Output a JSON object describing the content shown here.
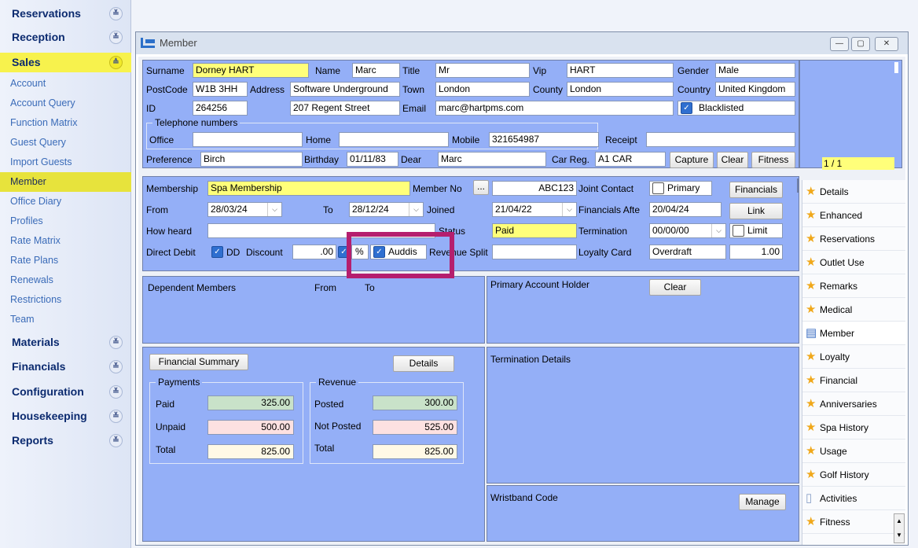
{
  "sidebar": {
    "sections": [
      {
        "label": "Reservations"
      },
      {
        "label": "Reception"
      },
      {
        "label": "Sales"
      }
    ],
    "sub_items": [
      "Account",
      "Account Query",
      "Function Matrix",
      "Guest Query",
      "Import Guests",
      "Member",
      "Office Diary",
      "Profiles",
      "Rate Matrix",
      "Rate Plans",
      "Renewals",
      "Restrictions",
      "Team"
    ],
    "bottom_sections": [
      "Materials",
      "Financials",
      "Configuration",
      "Housekeeping",
      "Reports"
    ],
    "active_section": "Sales",
    "active_item": "Member",
    "chevron_down": "≚",
    "chevron_up": "≙"
  },
  "window": {
    "title": "Member",
    "icon": "bed-icon"
  },
  "person": {
    "surname_label": "Surname",
    "surname": "Dorney HART",
    "name_label": "Name",
    "name": "Marc",
    "title_label": "Title",
    "title": "Mr",
    "vip_label": "Vip",
    "vip": "HART",
    "gender_label": "Gender",
    "gender": "Male",
    "postcode_label": "PostCode",
    "postcode": "W1B 3HH",
    "address_label": "Address",
    "address1": "Software Underground",
    "address2": "207 Regent Street",
    "town_label": "Town",
    "town": "London",
    "county_label": "County",
    "county": "London",
    "country_label": "Country",
    "country": "United Kingdom",
    "id_label": "ID",
    "id": "264256",
    "email_label": "Email",
    "email": "marc@hartpms.com",
    "blacklisted_label": "Blacklisted",
    "telephone_group": "Telephone numbers",
    "office_label": "Office",
    "office": "",
    "home_label": "Home",
    "home": "",
    "mobile_label": "Mobile",
    "mobile": "321654987",
    "receipt_label": "Receipt",
    "receipt": "",
    "preference_label": "Preference",
    "preference": "Birch",
    "birthday_label": "Birthday",
    "birthday": "01/11/83",
    "dear_label": "Dear",
    "dear": "Marc",
    "carreg_label": "Car Reg.",
    "carreg": "A1 CAR",
    "capture_btn": "Capture",
    "clear_btn": "Clear",
    "fitness_btn": "Fitness",
    "photo_counter": "1 / 1"
  },
  "membership": {
    "membership_label": "Membership",
    "membership": "Spa Membership",
    "member_no_label": "Member No",
    "member_no_btn": "...",
    "member_no": "ABC123",
    "joint_contact_label": "Joint Contact",
    "primary_label": "Primary",
    "financials_btn": "Financials",
    "from_label": "From",
    "from": "28/03/24",
    "to_label": "To",
    "to": "28/12/24",
    "joined_label": "Joined",
    "joined": "21/04/22",
    "financials_after_label": "Financials Afte",
    "financials_after": "20/04/24",
    "link_btn": "Link",
    "how_heard_label": "How heard",
    "how_heard": "",
    "status_label": "Status",
    "status": "Paid",
    "termination_label": "Termination",
    "termination": "00/00/00",
    "limit_label": "Limit",
    "direct_debit_label": "Direct Debit",
    "dd_label": "DD",
    "discount_label": "Discount",
    "discount": ".00",
    "percent_label": "%",
    "auddis_label": "Auddis",
    "revenue_split_label": "Revenue Split",
    "revenue_split": "",
    "loyalty_card_label": "Loyalty Card",
    "loyalty_card": "Overdraft",
    "loyalty_value": "1.00"
  },
  "dependents": {
    "title": "Dependent Members",
    "from": "From",
    "to": "To"
  },
  "primary_account": {
    "title": "Primary Account Holder",
    "clear_btn": "Clear"
  },
  "financial": {
    "summary_btn": "Financial Summary",
    "details_btn": "Details",
    "payments_group": "Payments",
    "revenue_group": "Revenue",
    "paid_label": "Paid",
    "paid": "325.00",
    "unpaid_label": "Unpaid",
    "unpaid": "500.00",
    "total_label": "Total",
    "total": "825.00",
    "posted_label": "Posted",
    "posted": "300.00",
    "not_posted_label": "Not Posted",
    "not_posted": "525.00",
    "rev_total_label": "Total",
    "rev_total": "825.00"
  },
  "termination_details": {
    "title": "Termination Details"
  },
  "wristband": {
    "title": "Wristband Code",
    "manage_btn": "Manage"
  },
  "tabs": [
    "Details",
    "Enhanced",
    "Reservations",
    "Outlet Use",
    "Remarks",
    "Medical",
    "Member",
    "Loyalty",
    "Financial",
    "Anniversaries",
    "Spa History",
    "Usage",
    "Golf History",
    "Activities",
    "Fitness"
  ],
  "active_tab": "Member",
  "colors": {
    "panel": "#94aff7",
    "highlight": "#b51f6e",
    "yellow_field": "#ffff7a",
    "sidebar_active": "#f7f24d"
  }
}
